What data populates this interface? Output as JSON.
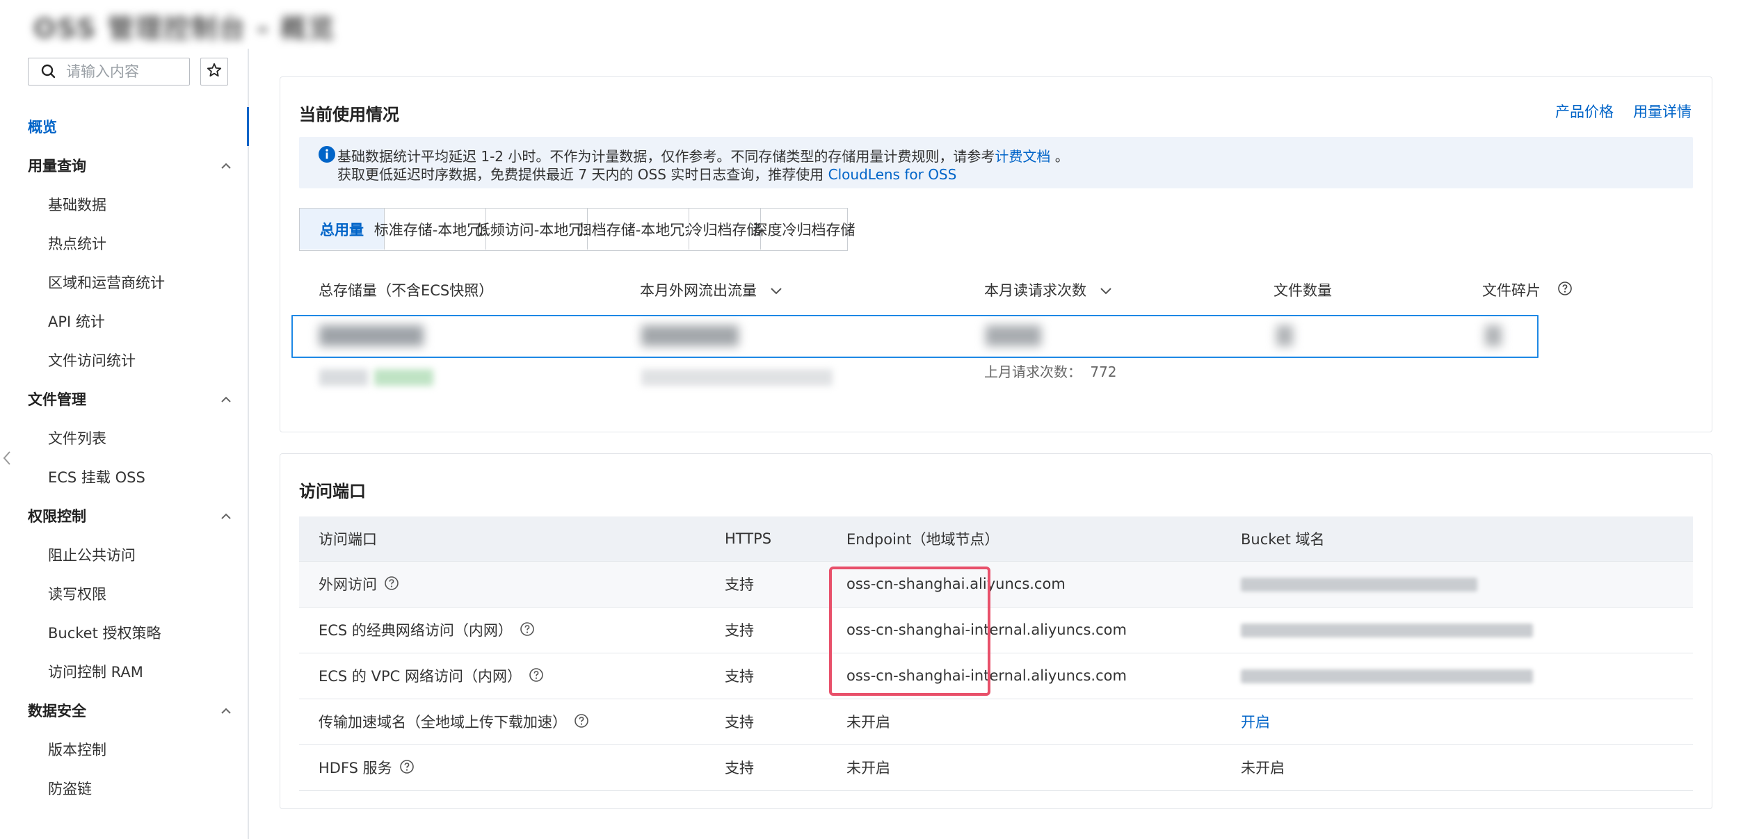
{
  "header": {
    "title": "OSS 管理控制台 - 概览"
  },
  "sidebar": {
    "search_placeholder": "请输入内容",
    "top_item": "概览",
    "groups": [
      {
        "label": "用量查询",
        "items": [
          "基础数据",
          "热点统计",
          "区域和运营商统计",
          "API 统计",
          "文件访问统计"
        ]
      },
      {
        "label": "文件管理",
        "items": [
          "文件列表",
          "ECS 挂载 OSS"
        ]
      },
      {
        "label": "权限控制",
        "items": [
          "阻止公共访问",
          "读写权限",
          "Bucket 授权策略",
          "访问控制 RAM"
        ]
      },
      {
        "label": "数据安全",
        "items": [
          "版本控制",
          "防盗链"
        ]
      }
    ]
  },
  "usage": {
    "title": "当前使用情况",
    "price_link": "产品价格",
    "detail_link": "用量详情",
    "notice_line1_prefix": "基础数据统计平均延迟 1-2 小时。不作为计量数据，仅作参考。不同存储类型的存储用量计费规则，请参考",
    "notice_line1_link": "计费文档",
    "notice_line1_suffix": "。",
    "notice_line2_prefix": "获取更低延迟时序数据，免费提供最近 7 天内的 OSS 实时日志查询，推荐使用",
    "notice_line2_link": "CloudLens for OSS",
    "tabs": [
      "总用量",
      "标准存储-本地冗余",
      "低频访问-本地冗余",
      "归档存储-本地冗余",
      "冷归档存储",
      "深度冷归档存储"
    ],
    "active_tab": 0,
    "metrics": [
      {
        "label": "总存储量（不含ECS快照）"
      },
      {
        "label": "本月外网流出流量"
      },
      {
        "label": "本月读请求次数"
      },
      {
        "label": "文件数量"
      },
      {
        "label": "文件碎片"
      }
    ],
    "last_month_label": "上月请求次数：",
    "last_month_value": "772"
  },
  "endpoint": {
    "title": "访问端口",
    "headers": [
      "访问端口",
      "HTTPS",
      "Endpoint（地域节点）",
      "Bucket 域名"
    ],
    "rows": [
      {
        "port": "外网访问",
        "https": "支持",
        "endpoint": "oss-cn-shanghai.aliyuncs.com",
        "bucket": ""
      },
      {
        "port": "ECS 的经典网络访问（内网）",
        "https": "支持",
        "endpoint": "oss-cn-shanghai-internal.aliyuncs.com",
        "bucket": ""
      },
      {
        "port": "ECS 的 VPC 网络访问（内网）",
        "https": "支持",
        "endpoint": "oss-cn-shanghai-internal.aliyuncs.com",
        "bucket": ""
      },
      {
        "port": "传输加速域名（全地域上传下载加速）",
        "https": "支持",
        "endpoint": "未开启",
        "bucket": "开启"
      },
      {
        "port": "HDFS 服务",
        "https": "支持",
        "endpoint": "未开启",
        "bucket": "未开启"
      }
    ]
  },
  "colors": {
    "accent": "#0064c8",
    "highlight_border": "#e8506a",
    "metric_border": "#1e88e5"
  },
  "icons": [
    "search-icon",
    "star-icon",
    "chevron-up-icon",
    "chevron-down-icon",
    "info-icon",
    "question-icon",
    "chevron-left-icon"
  ]
}
